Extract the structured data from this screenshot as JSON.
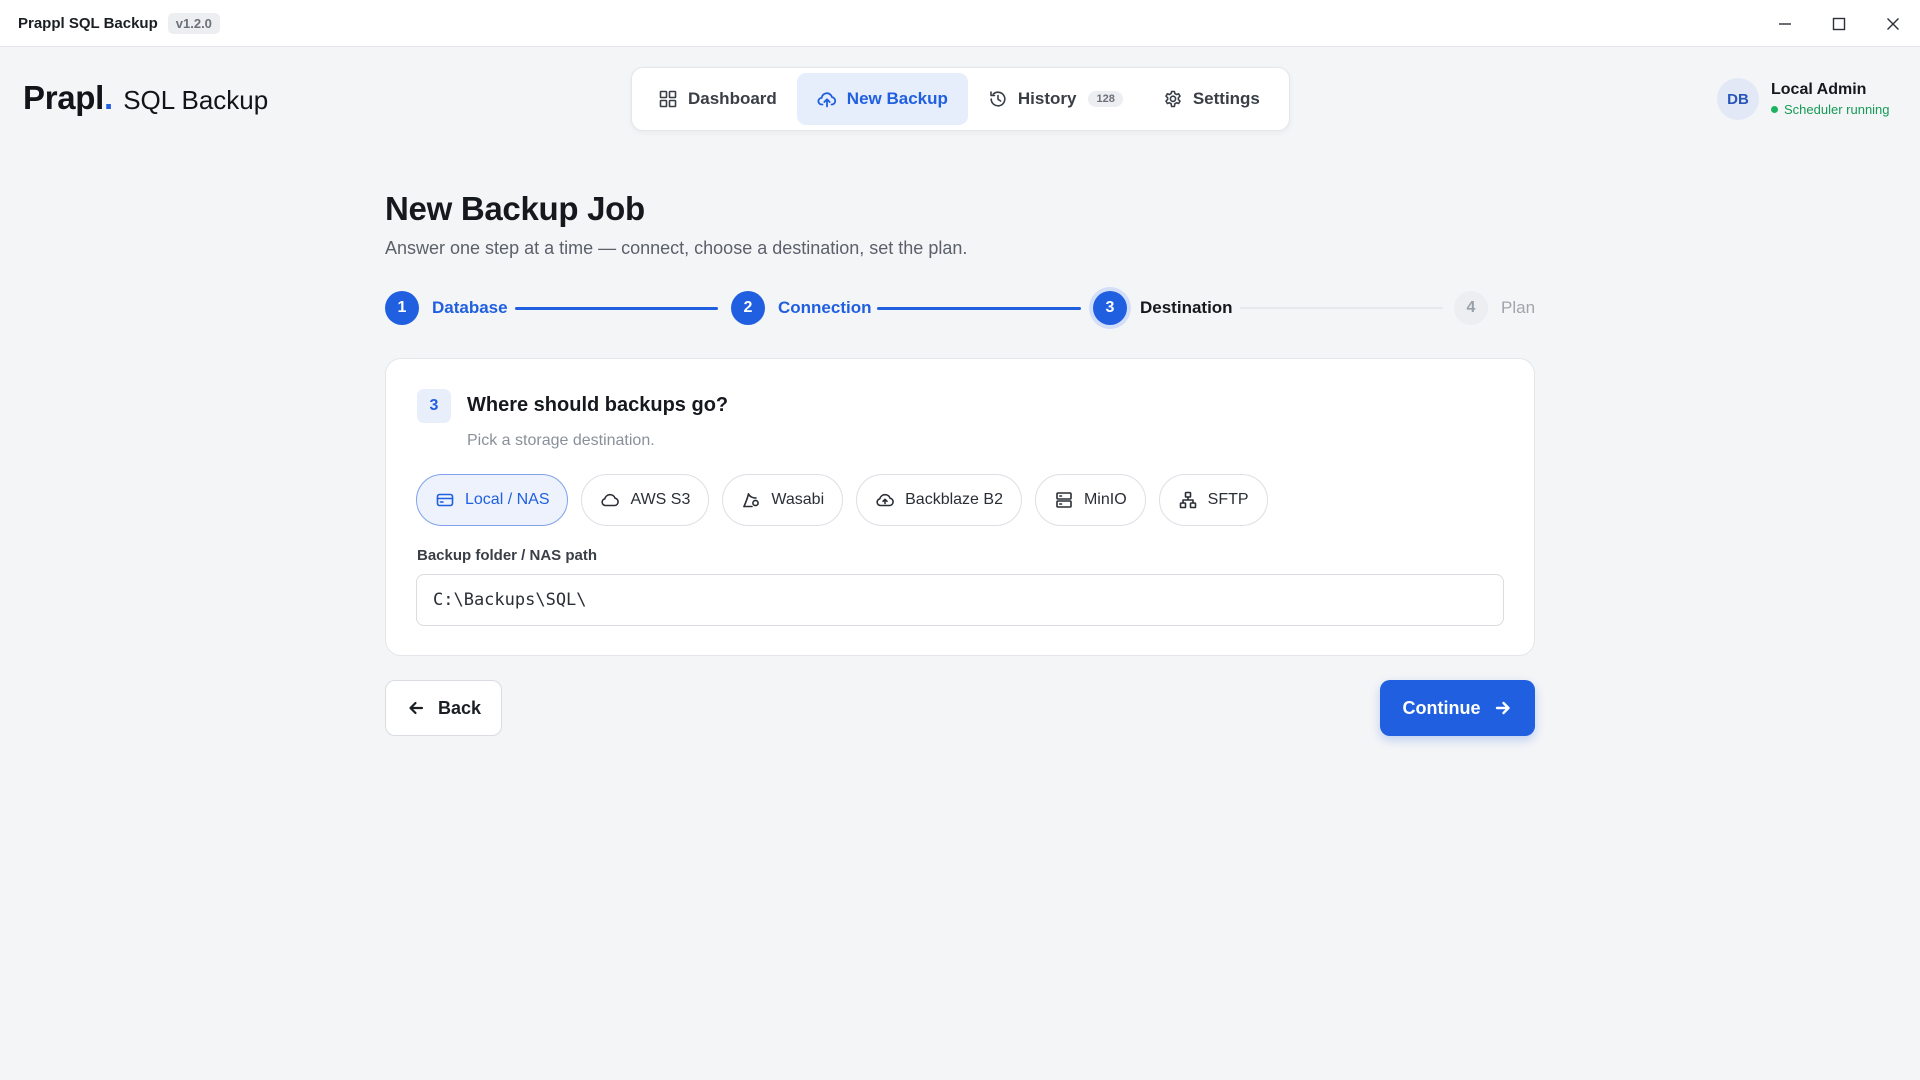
{
  "window": {
    "app_name": "Prappl SQL Backup",
    "version": "v1.2.0"
  },
  "brand": {
    "name": "Prapl",
    "dot": ".",
    "product": "SQL Backup"
  },
  "nav": {
    "items": [
      {
        "label": "Dashboard",
        "icon": "dashboard-grid-icon",
        "active": false
      },
      {
        "label": "New Backup",
        "icon": "cloud-upload-icon",
        "active": true
      },
      {
        "label": "History",
        "icon": "history-icon",
        "active": false,
        "badge": "128"
      },
      {
        "label": "Settings",
        "icon": "gear-icon",
        "active": false
      }
    ]
  },
  "user": {
    "initials": "DB",
    "name": "Local Admin",
    "status": "Scheduler running"
  },
  "page": {
    "title": "New Backup Job",
    "subtitle": "Answer one step at a time — connect, choose a destination, set the plan."
  },
  "stepper": {
    "steps": [
      {
        "num": "1",
        "label": "Database",
        "state": "done"
      },
      {
        "num": "2",
        "label": "Connection",
        "state": "done"
      },
      {
        "num": "3",
        "label": "Destination",
        "state": "current"
      },
      {
        "num": "4",
        "label": "Plan",
        "state": "todo"
      }
    ]
  },
  "question": {
    "num": "3",
    "title": "Where should backups go?",
    "hint": "Pick a storage destination.",
    "destinations": [
      {
        "label": "Local / NAS",
        "icon": "drive-icon",
        "selected": true
      },
      {
        "label": "AWS S3",
        "icon": "cloud-icon",
        "selected": false
      },
      {
        "label": "Wasabi",
        "icon": "wasabi-icon",
        "selected": false
      },
      {
        "label": "Backblaze B2",
        "icon": "cloud-storage-icon",
        "selected": false
      },
      {
        "label": "MinIO",
        "icon": "server-icon",
        "selected": false
      },
      {
        "label": "SFTP",
        "icon": "network-icon",
        "selected": false
      }
    ],
    "path_label": "Backup folder / NAS path",
    "path_value": "C:\\Backups\\SQL\\"
  },
  "actions": {
    "back": "Back",
    "continue": "Continue"
  },
  "colors": {
    "accent": "#1f5fe0",
    "success": "#1bb35f",
    "background": "#f4f5f7"
  }
}
